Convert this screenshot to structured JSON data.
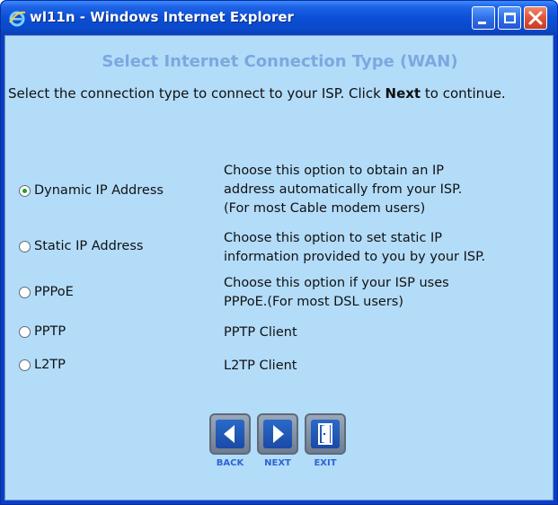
{
  "window": {
    "title": "wl11n - Windows Internet Explorer",
    "icon": "ie-icon"
  },
  "page": {
    "heading": "Select Internet Connection Type (WAN)",
    "intro_before": "Select the connection type to connect to your ISP. Click ",
    "intro_bold": "Next",
    "intro_after": " to continue."
  },
  "options": [
    {
      "label": "Dynamic IP Address",
      "checked": true,
      "desc_lines": [
        "Choose this option to obtain an IP",
        "address automatically from your ISP.",
        "(For most Cable modem users)"
      ]
    },
    {
      "label": "Static IP Address",
      "checked": false,
      "desc_lines": [
        "Choose this option to set static IP",
        "information provided to you by your ISP."
      ]
    },
    {
      "label": "PPPoE",
      "checked": false,
      "desc_lines": [
        "Choose this option if your ISP uses",
        "PPPoE.(For most DSL users)"
      ]
    },
    {
      "label": "PPTP",
      "checked": false,
      "desc_lines": [
        "PPTP Client"
      ]
    },
    {
      "label": "L2TP",
      "checked": false,
      "desc_lines": [
        "L2TP Client"
      ]
    }
  ],
  "nav": {
    "back_label": "BACK",
    "next_label": "NEXT",
    "exit_label": "EXIT"
  },
  "colors": {
    "titlebar": "#0b4fd6",
    "content_bg": "#b3dcf9",
    "heading": "#7ca8df",
    "nav_label": "#2f63d6"
  }
}
